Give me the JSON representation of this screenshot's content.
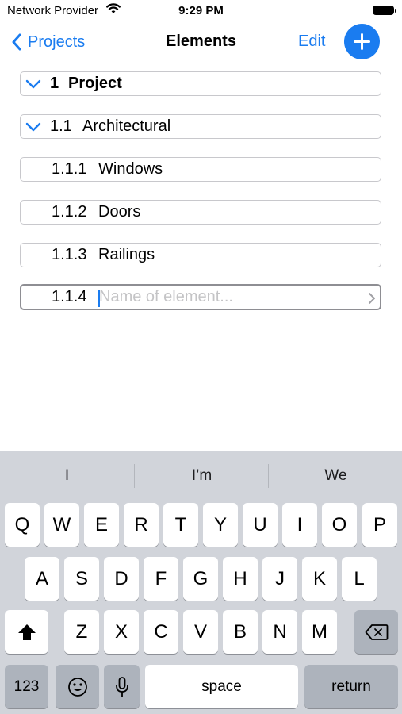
{
  "status_bar": {
    "carrier": "Network Provider",
    "time": "9:29 PM"
  },
  "nav": {
    "back_label": "Projects",
    "title": "Elements",
    "edit_label": "Edit"
  },
  "rows": [
    {
      "number": "1",
      "label": "Project"
    },
    {
      "number": "1.1",
      "label": "Architectural"
    },
    {
      "number": "1.1.1",
      "label": "Windows"
    },
    {
      "number": "1.1.2",
      "label": "Doors"
    },
    {
      "number": "1.1.3",
      "label": "Railings"
    }
  ],
  "new_element": {
    "number": "1.1.4",
    "placeholder": "Name of element..."
  },
  "keyboard": {
    "suggestions": [
      "I",
      "I’m",
      "We"
    ],
    "row1": [
      "Q",
      "W",
      "E",
      "R",
      "T",
      "Y",
      "U",
      "I",
      "O",
      "P"
    ],
    "row2": [
      "A",
      "S",
      "D",
      "F",
      "G",
      "H",
      "J",
      "K",
      "L"
    ],
    "row3": [
      "Z",
      "X",
      "C",
      "V",
      "B",
      "N",
      "M"
    ],
    "numbers_key": "123",
    "space_key": "space",
    "return_key": "return"
  },
  "colors": {
    "accent": "#1a7cf0",
    "keyboard_bg": "#d1d4da",
    "dark_key": "#adb3bc"
  }
}
